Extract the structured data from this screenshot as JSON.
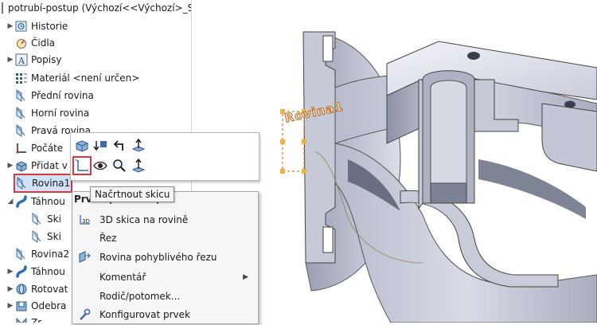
{
  "tree": {
    "header": "potrubí-postup  (Výchozí<<Výchozí>_Sta",
    "items": [
      {
        "label": "Historie",
        "icon": "history-icon"
      },
      {
        "label": "Čidla",
        "icon": "sensors-icon"
      },
      {
        "label": "Popisy",
        "icon": "annotations-icon"
      },
      {
        "label": "Materiál <není určen>",
        "icon": "material-icon"
      },
      {
        "label": "Přední rovina",
        "icon": "plane-icon"
      },
      {
        "label": "Horní rovina",
        "icon": "plane-icon"
      },
      {
        "label": "Pravá rovina",
        "icon": "plane-icon"
      },
      {
        "label": "Počáte",
        "icon": "origin-icon"
      },
      {
        "label": "Přidat v",
        "icon": "extrude-icon"
      },
      {
        "label": "Rovina1",
        "icon": "plane-icon"
      },
      {
        "label": "Táhnou",
        "icon": "sweep-icon"
      },
      {
        "label": "Ski",
        "icon": "sketch-icon"
      },
      {
        "label": "Ski",
        "icon": "sketch-icon"
      },
      {
        "label": "Rovina2",
        "icon": "plane-icon"
      },
      {
        "label": "Táhnou",
        "icon": "sweep-icon"
      },
      {
        "label": "Rotovat",
        "icon": "revolve-icon"
      },
      {
        "label": "Odebra",
        "icon": "cut-icon"
      },
      {
        "label": "Zr",
        "icon": "mirror-icon"
      }
    ]
  },
  "viewport": {
    "plane_label": "Rovina1"
  },
  "mini_toolbar": {
    "buttons": [
      "edit-feature-icon",
      "rollback-icon",
      "undo-icon",
      "normal-to-icon",
      "sketch-icon",
      "show-icon",
      "zoom-selection-icon",
      "normal-to-plane-icon"
    ]
  },
  "tooltip": "Načrtnout skicu",
  "context_menu": {
    "header": "Prvek (Rovina1)",
    "items": [
      {
        "label": "3D skica na rovině",
        "icon": "sketch3d-icon",
        "submenu": false
      },
      {
        "label": "Řez",
        "icon": "section-icon",
        "submenu": false
      },
      {
        "label": "Rovina pohyblivého řezu",
        "icon": "moving-section-icon",
        "submenu": false
      },
      {
        "label": "Komentář",
        "icon": "",
        "submenu": true
      },
      {
        "label": "Rodič/potomek...",
        "icon": "",
        "submenu": false
      },
      {
        "label": "Konfigurovat prvek",
        "icon": "configure-icon",
        "submenu": false
      }
    ]
  },
  "colors": {
    "highlight": "#e0373b",
    "selection": "#cfe3f7",
    "model": "#c7cad8"
  }
}
